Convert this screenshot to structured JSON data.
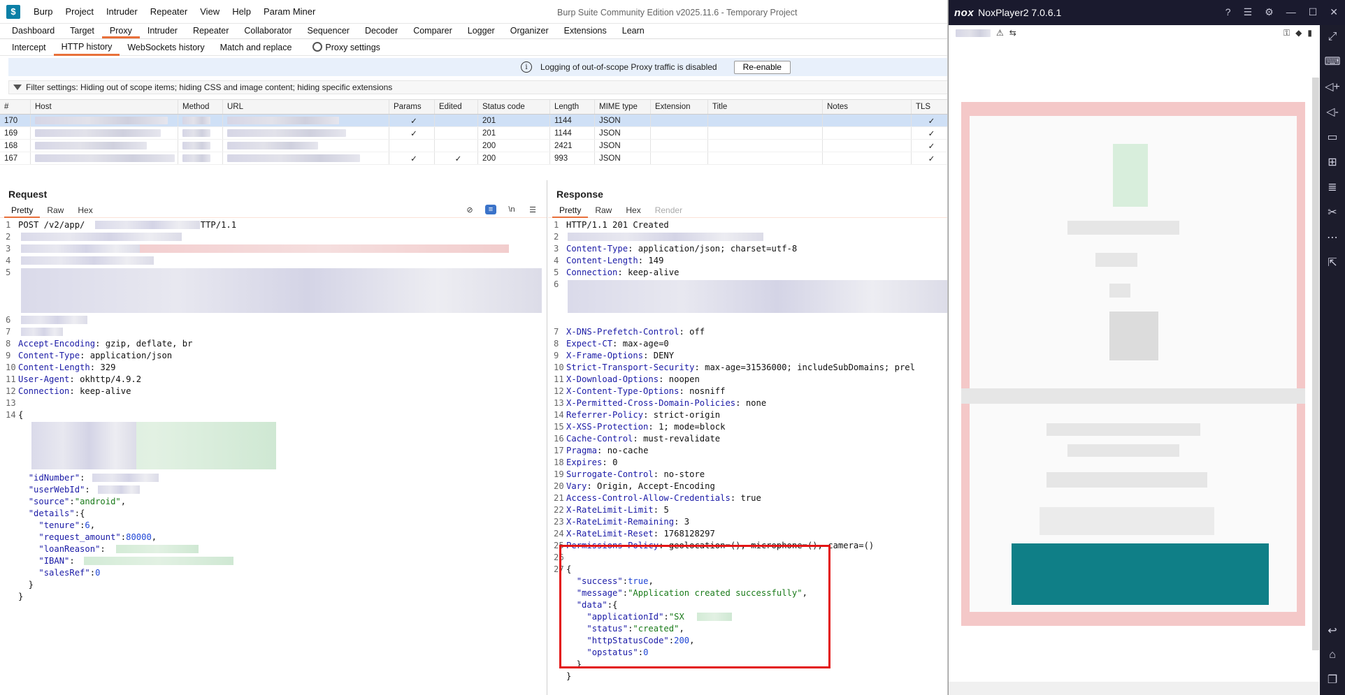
{
  "burp": {
    "menu": [
      "Burp",
      "Project",
      "Intruder",
      "Repeater",
      "View",
      "Help",
      "Param Miner"
    ],
    "window_title": "Burp Suite Community Edition v2025.11.6 - Temporary Project",
    "main_tabs": [
      "Dashboard",
      "Target",
      "Proxy",
      "Intruder",
      "Repeater",
      "Collaborator",
      "Sequencer",
      "Decoder",
      "Comparer",
      "Logger",
      "Organizer",
      "Extensions",
      "Learn"
    ],
    "main_tab_active": "Proxy",
    "proxy_tabs": [
      "Intercept",
      "HTTP history",
      "WebSockets history",
      "Match and replace"
    ],
    "proxy_tab_active": "HTTP history",
    "proxy_settings_label": "Proxy settings",
    "notice_text": "Logging of out-of-scope Proxy traffic is disabled",
    "reenable_label": "Re-enable",
    "filter_text": "Filter settings: Hiding out of scope items;  hiding CSS and image content;  hiding specific extensions",
    "history_columns": [
      "#",
      "Host",
      "Method",
      "URL",
      "Params",
      "Edited",
      "Status code",
      "Length",
      "MIME type",
      "Extension",
      "Title",
      "Notes",
      "TLS"
    ],
    "history_rows": [
      {
        "num": "170",
        "params": "✓",
        "edited": "",
        "status": "201",
        "length": "1144",
        "mime": "JSON",
        "tls": "✓",
        "selected": true
      },
      {
        "num": "169",
        "params": "✓",
        "edited": "",
        "status": "201",
        "length": "1144",
        "mime": "JSON",
        "tls": "✓",
        "selected": false
      },
      {
        "num": "168",
        "params": "",
        "edited": "",
        "status": "200",
        "length": "2421",
        "mime": "JSON",
        "tls": "✓",
        "selected": false
      },
      {
        "num": "167",
        "params": "✓",
        "edited": "✓",
        "status": "200",
        "length": "993",
        "mime": "JSON",
        "tls": "✓",
        "selected": false
      }
    ],
    "request": {
      "title": "Request",
      "tabs": [
        "Pretty",
        "Raw",
        "Hex"
      ],
      "line1_method": "POST /v2/app/",
      "line1_proto": "HTTP/1.1",
      "headers": [
        {
          "n": "8",
          "k": "Accept-Encoding",
          "v": "gzip, deflate, br"
        },
        {
          "n": "9",
          "k": "Content-Type",
          "v": "application/json"
        },
        {
          "n": "10",
          "k": "Content-Length",
          "v": "329"
        },
        {
          "n": "11",
          "k": "User-Agent",
          "v": "okhttp/4.9.2"
        },
        {
          "n": "12",
          "k": "Connection",
          "v": "keep-alive"
        }
      ],
      "body_keys": {
        "idNumber": "\"idNumber\"",
        "userWebId": "\"userWebId\"",
        "source_key": "\"source\"",
        "source_val": "\"android\"",
        "details": "\"details\"",
        "tenure_key": "\"tenure\"",
        "tenure_val": "6",
        "amount_key": "\"request_amount\"",
        "amount_val": "80000",
        "reason_key": "\"loanReason\"",
        "iban_key": "\"IBAN\"",
        "sales_key": "\"salesRef\"",
        "sales_val": "0"
      }
    },
    "response": {
      "title": "Response",
      "tabs": [
        "Pretty",
        "Raw",
        "Hex",
        "Render"
      ],
      "status_line": "HTTP/1.1 201 Created",
      "headers_top": [
        {
          "n": "3",
          "k": "Content-Type",
          "v": "application/json; charset=utf-8"
        },
        {
          "n": "4",
          "k": "Content-Length",
          "v": "149"
        },
        {
          "n": "5",
          "k": "Connection",
          "v": "keep-alive"
        }
      ],
      "headers": [
        {
          "n": "7",
          "k": "X-DNS-Prefetch-Control",
          "v": "off"
        },
        {
          "n": "8",
          "k": "Expect-CT",
          "v": "max-age=0"
        },
        {
          "n": "9",
          "k": "X-Frame-Options",
          "v": "DENY"
        },
        {
          "n": "10",
          "k": "Strict-Transport-Security",
          "v": "max-age=31536000; includeSubDomains; prel"
        },
        {
          "n": "11",
          "k": "X-Download-Options",
          "v": "noopen"
        },
        {
          "n": "12",
          "k": "X-Content-Type-Options",
          "v": "nosniff"
        },
        {
          "n": "13",
          "k": "X-Permitted-Cross-Domain-Policies",
          "v": "none"
        },
        {
          "n": "14",
          "k": "Referrer-Policy",
          "v": "strict-origin"
        },
        {
          "n": "15",
          "k": "X-XSS-Protection",
          "v": "1; mode=block"
        },
        {
          "n": "16",
          "k": "Cache-Control",
          "v": "must-revalidate"
        },
        {
          "n": "17",
          "k": "Pragma",
          "v": "no-cache"
        },
        {
          "n": "18",
          "k": "Expires",
          "v": "0"
        },
        {
          "n": "19",
          "k": "Surrogate-Control",
          "v": "no-store"
        },
        {
          "n": "20",
          "k": "Vary",
          "v": "Origin, Accept-Encoding"
        },
        {
          "n": "21",
          "k": "Access-Control-Allow-Credentials",
          "v": "true"
        },
        {
          "n": "22",
          "k": "X-RateLimit-Limit",
          "v": "5"
        },
        {
          "n": "23",
          "k": "X-RateLimit-Remaining",
          "v": "3"
        },
        {
          "n": "24",
          "k": "X-RateLimit-Reset",
          "v": "1768128297"
        },
        {
          "n": "25",
          "k": "Permissions-Policy",
          "v": "geolocation=(), microphone=(), camera=()"
        }
      ],
      "body": {
        "success_key": "\"success\"",
        "success_val": "true",
        "message_key": "\"message\"",
        "message_val": "\"Application created successfully\"",
        "data_key": "\"data\"",
        "appid_key": "\"applicationId\"",
        "appid_val": "\"SX",
        "status_key": "\"status\"",
        "status_val": "\"created\"",
        "http_key": "\"httpStatusCode\"",
        "http_val": "200",
        "op_key": "\"opstatus\"",
        "op_val": "0"
      }
    }
  },
  "nox": {
    "logo": "nox",
    "title": "NoxPlayer2 7.0.6.1"
  },
  "colors": {
    "accent_orange": "#e8703a",
    "highlight_red": "#e31414",
    "nox_teal": "#0f7f87"
  }
}
